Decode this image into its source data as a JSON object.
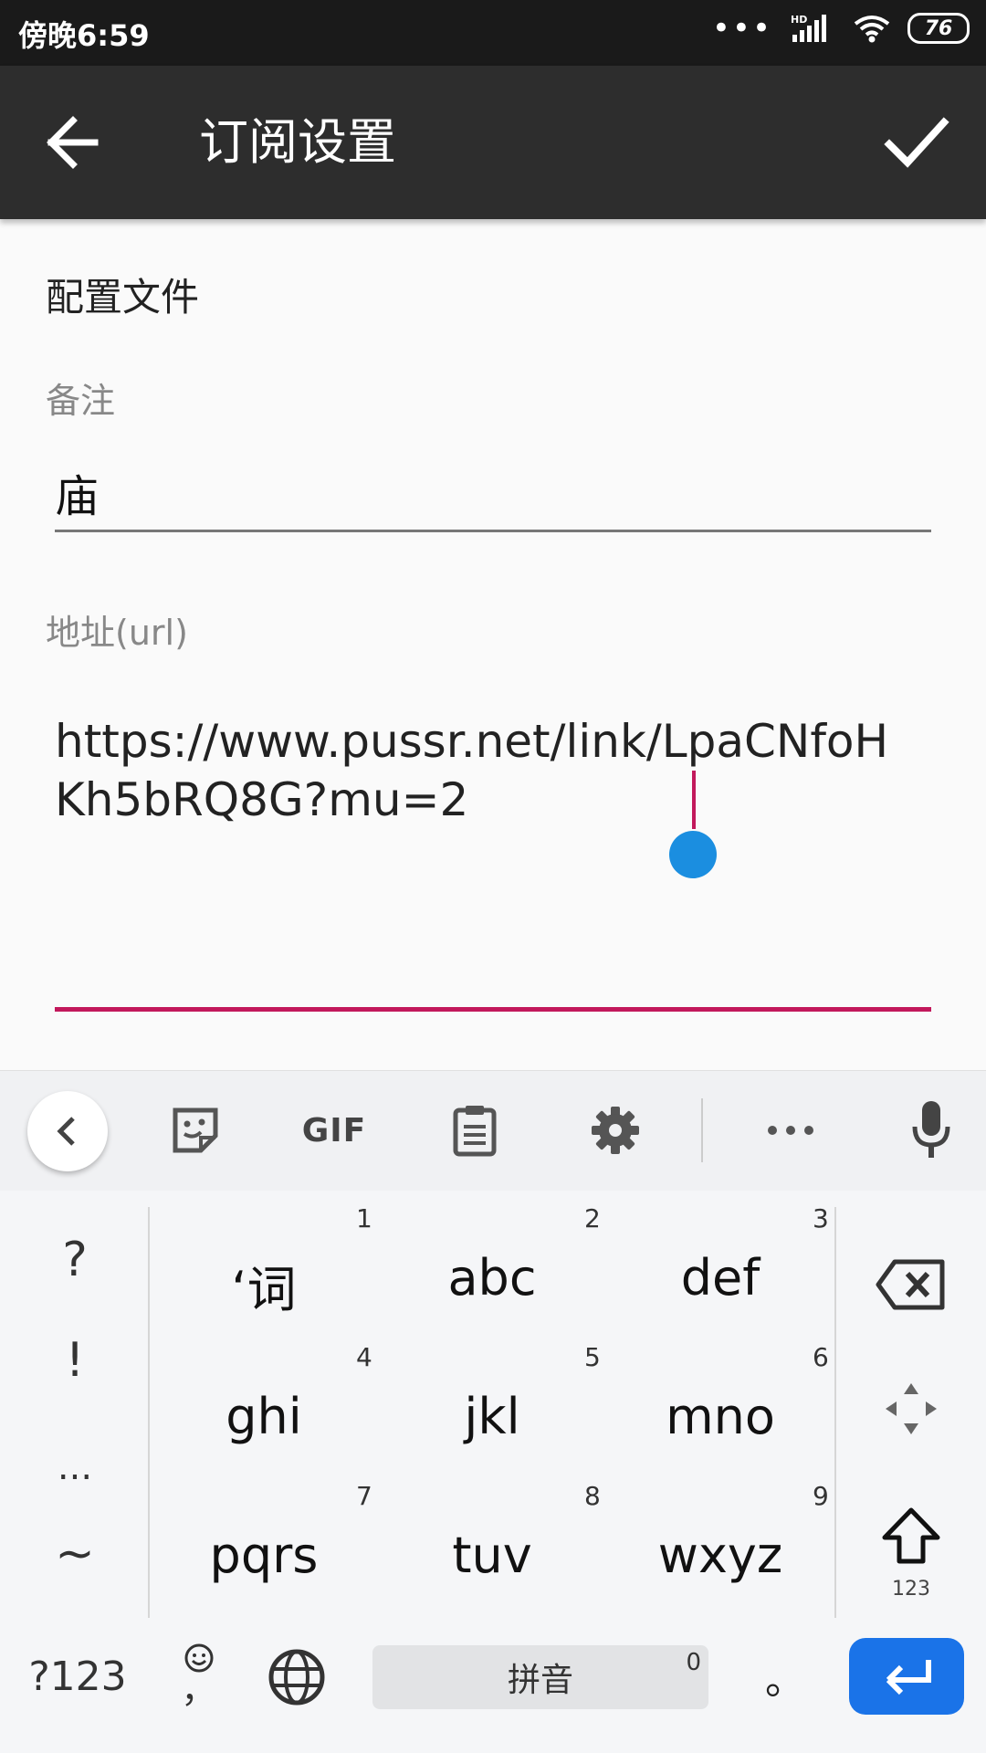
{
  "status_bar": {
    "time": "傍晚6:59",
    "network_label": "HD",
    "battery": "76"
  },
  "app_bar": {
    "title": "订阅设置"
  },
  "form": {
    "section_heading": "配置文件",
    "remark": {
      "label": "备注",
      "value": "庙"
    },
    "url": {
      "label": "地址(url)",
      "value": "https://www.pussr.net/link/LpaCNfoHKh5bRQ8G?mu=2"
    }
  },
  "keyboard": {
    "toolbar": {
      "gif_label": "GIF"
    },
    "punctuation": [
      "?",
      "!",
      "...",
      "~"
    ],
    "keys": [
      {
        "label": "‘词",
        "num": "1"
      },
      {
        "label": "abc",
        "num": "2"
      },
      {
        "label": "def",
        "num": "3"
      },
      {
        "label": "ghi",
        "num": "4"
      },
      {
        "label": "jkl",
        "num": "5"
      },
      {
        "label": "mno",
        "num": "6"
      },
      {
        "label": "pqrs",
        "num": "7"
      },
      {
        "label": "tuv",
        "num": "8"
      },
      {
        "label": "wxyz",
        "num": "9"
      }
    ],
    "shift_sub": "123",
    "symbols_label": "?123",
    "comma_label": "，",
    "space_label": "拼音",
    "space_num": "0",
    "period_label": "。"
  },
  "colors": {
    "app_bar": "#2d2d2d",
    "accent_underline": "#c2185b",
    "caret_handle": "#1b8ee0",
    "enter_key": "#1a73e8"
  }
}
